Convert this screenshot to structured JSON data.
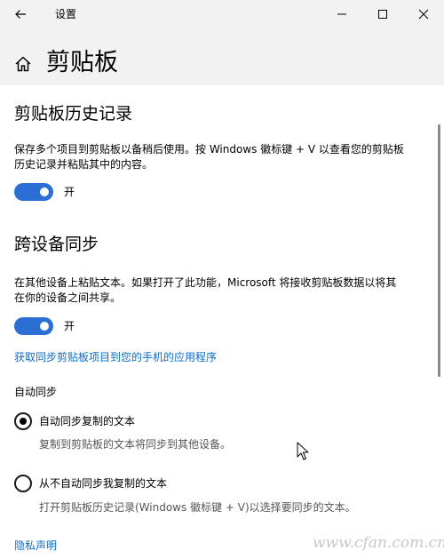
{
  "window": {
    "title": "设置",
    "back_icon": "arrow-left-icon",
    "controls": [
      "minimize-icon",
      "maximize-icon",
      "close-icon"
    ]
  },
  "header": {
    "home_icon": "home-icon",
    "page_title": "剪贴板"
  },
  "clipboard_history": {
    "title": "剪贴板历史记录",
    "description": "保存多个项目到剪贴板以备稍后使用。按 Windows 徽标键 + V 以查看您的剪贴板历史记录并粘贴其中的内容。",
    "toggle_state": "开",
    "toggle_on": true
  },
  "sync": {
    "title": "跨设备同步",
    "description": "在其他设备上粘贴文本。如果打开了此功能，Microsoft 将接收剪贴板数据以将其在你的设备之间共享。",
    "toggle_state": "开",
    "toggle_on": true,
    "phone_link": "获取同步剪贴板项目到您的手机的应用程序",
    "auto_sync_heading": "自动同步",
    "options": [
      {
        "label": "自动同步复制的文本",
        "description": "复制到剪贴板的文本将同步到其他设备。",
        "selected": true
      },
      {
        "label": "从不自动同步我复制的文本",
        "description": "打开剪贴板历史记录(Windows 徽标键 + V)以选择要同步的文本。",
        "selected": false
      }
    ]
  },
  "privacy_link": "隐私声明",
  "watermark": "www.cfan.com.cn",
  "colors": {
    "accent": "#2b6ed4",
    "link": "#0c6cc6",
    "header_bg": "#f2f2f2"
  }
}
